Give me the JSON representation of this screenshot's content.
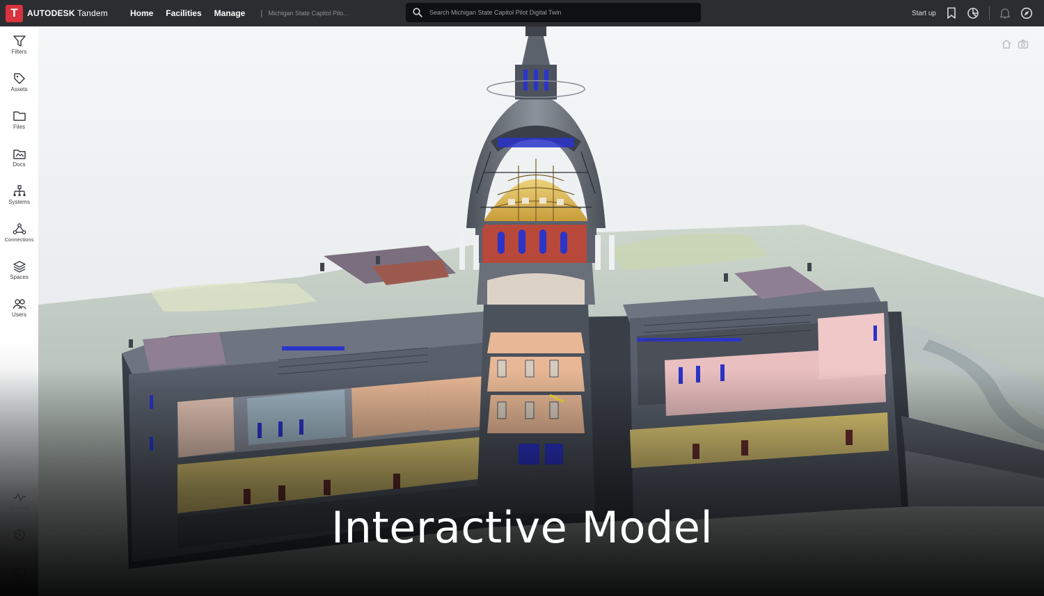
{
  "topbar": {
    "logo_letter": "T",
    "brand_bold": "AUTODESK",
    "brand_rest": " Tandem",
    "nav": [
      "Home",
      "Facilities",
      "Manage"
    ],
    "breadcrumb": "Michigan State Capitol Pilo...",
    "search_placeholder": "Search Michigan State Capitol Pilot Digital Twin",
    "startup_label": "Start up"
  },
  "sidebar": {
    "items": [
      {
        "label": "Filters",
        "icon": "filter-icon"
      },
      {
        "label": "Assets",
        "icon": "tag-icon"
      },
      {
        "label": "Files",
        "icon": "folder-icon"
      },
      {
        "label": "Docs",
        "icon": "docs-icon"
      },
      {
        "label": "Systems",
        "icon": "hierarchy-icon"
      },
      {
        "label": "Connections",
        "icon": "connections-icon"
      },
      {
        "label": "Spaces",
        "icon": "layers-icon"
      },
      {
        "label": "Users",
        "icon": "users-icon"
      }
    ],
    "bottom_items": [
      {
        "label": "Streams",
        "icon": "pulse-icon"
      },
      {
        "label": "History",
        "icon": "history-icon"
      }
    ]
  },
  "caption": "Interactive Model",
  "colors": {
    "topbar_bg": "#2b2d30",
    "logo_red": "#d8333f",
    "dome_gold": "#e0c060",
    "wall_peach": "#e8b896",
    "wall_pink": "#f0c0c0",
    "floor_yellow": "#e8d27a",
    "window_blue": "#2b34c8",
    "terrain": "#c6cfc2"
  }
}
